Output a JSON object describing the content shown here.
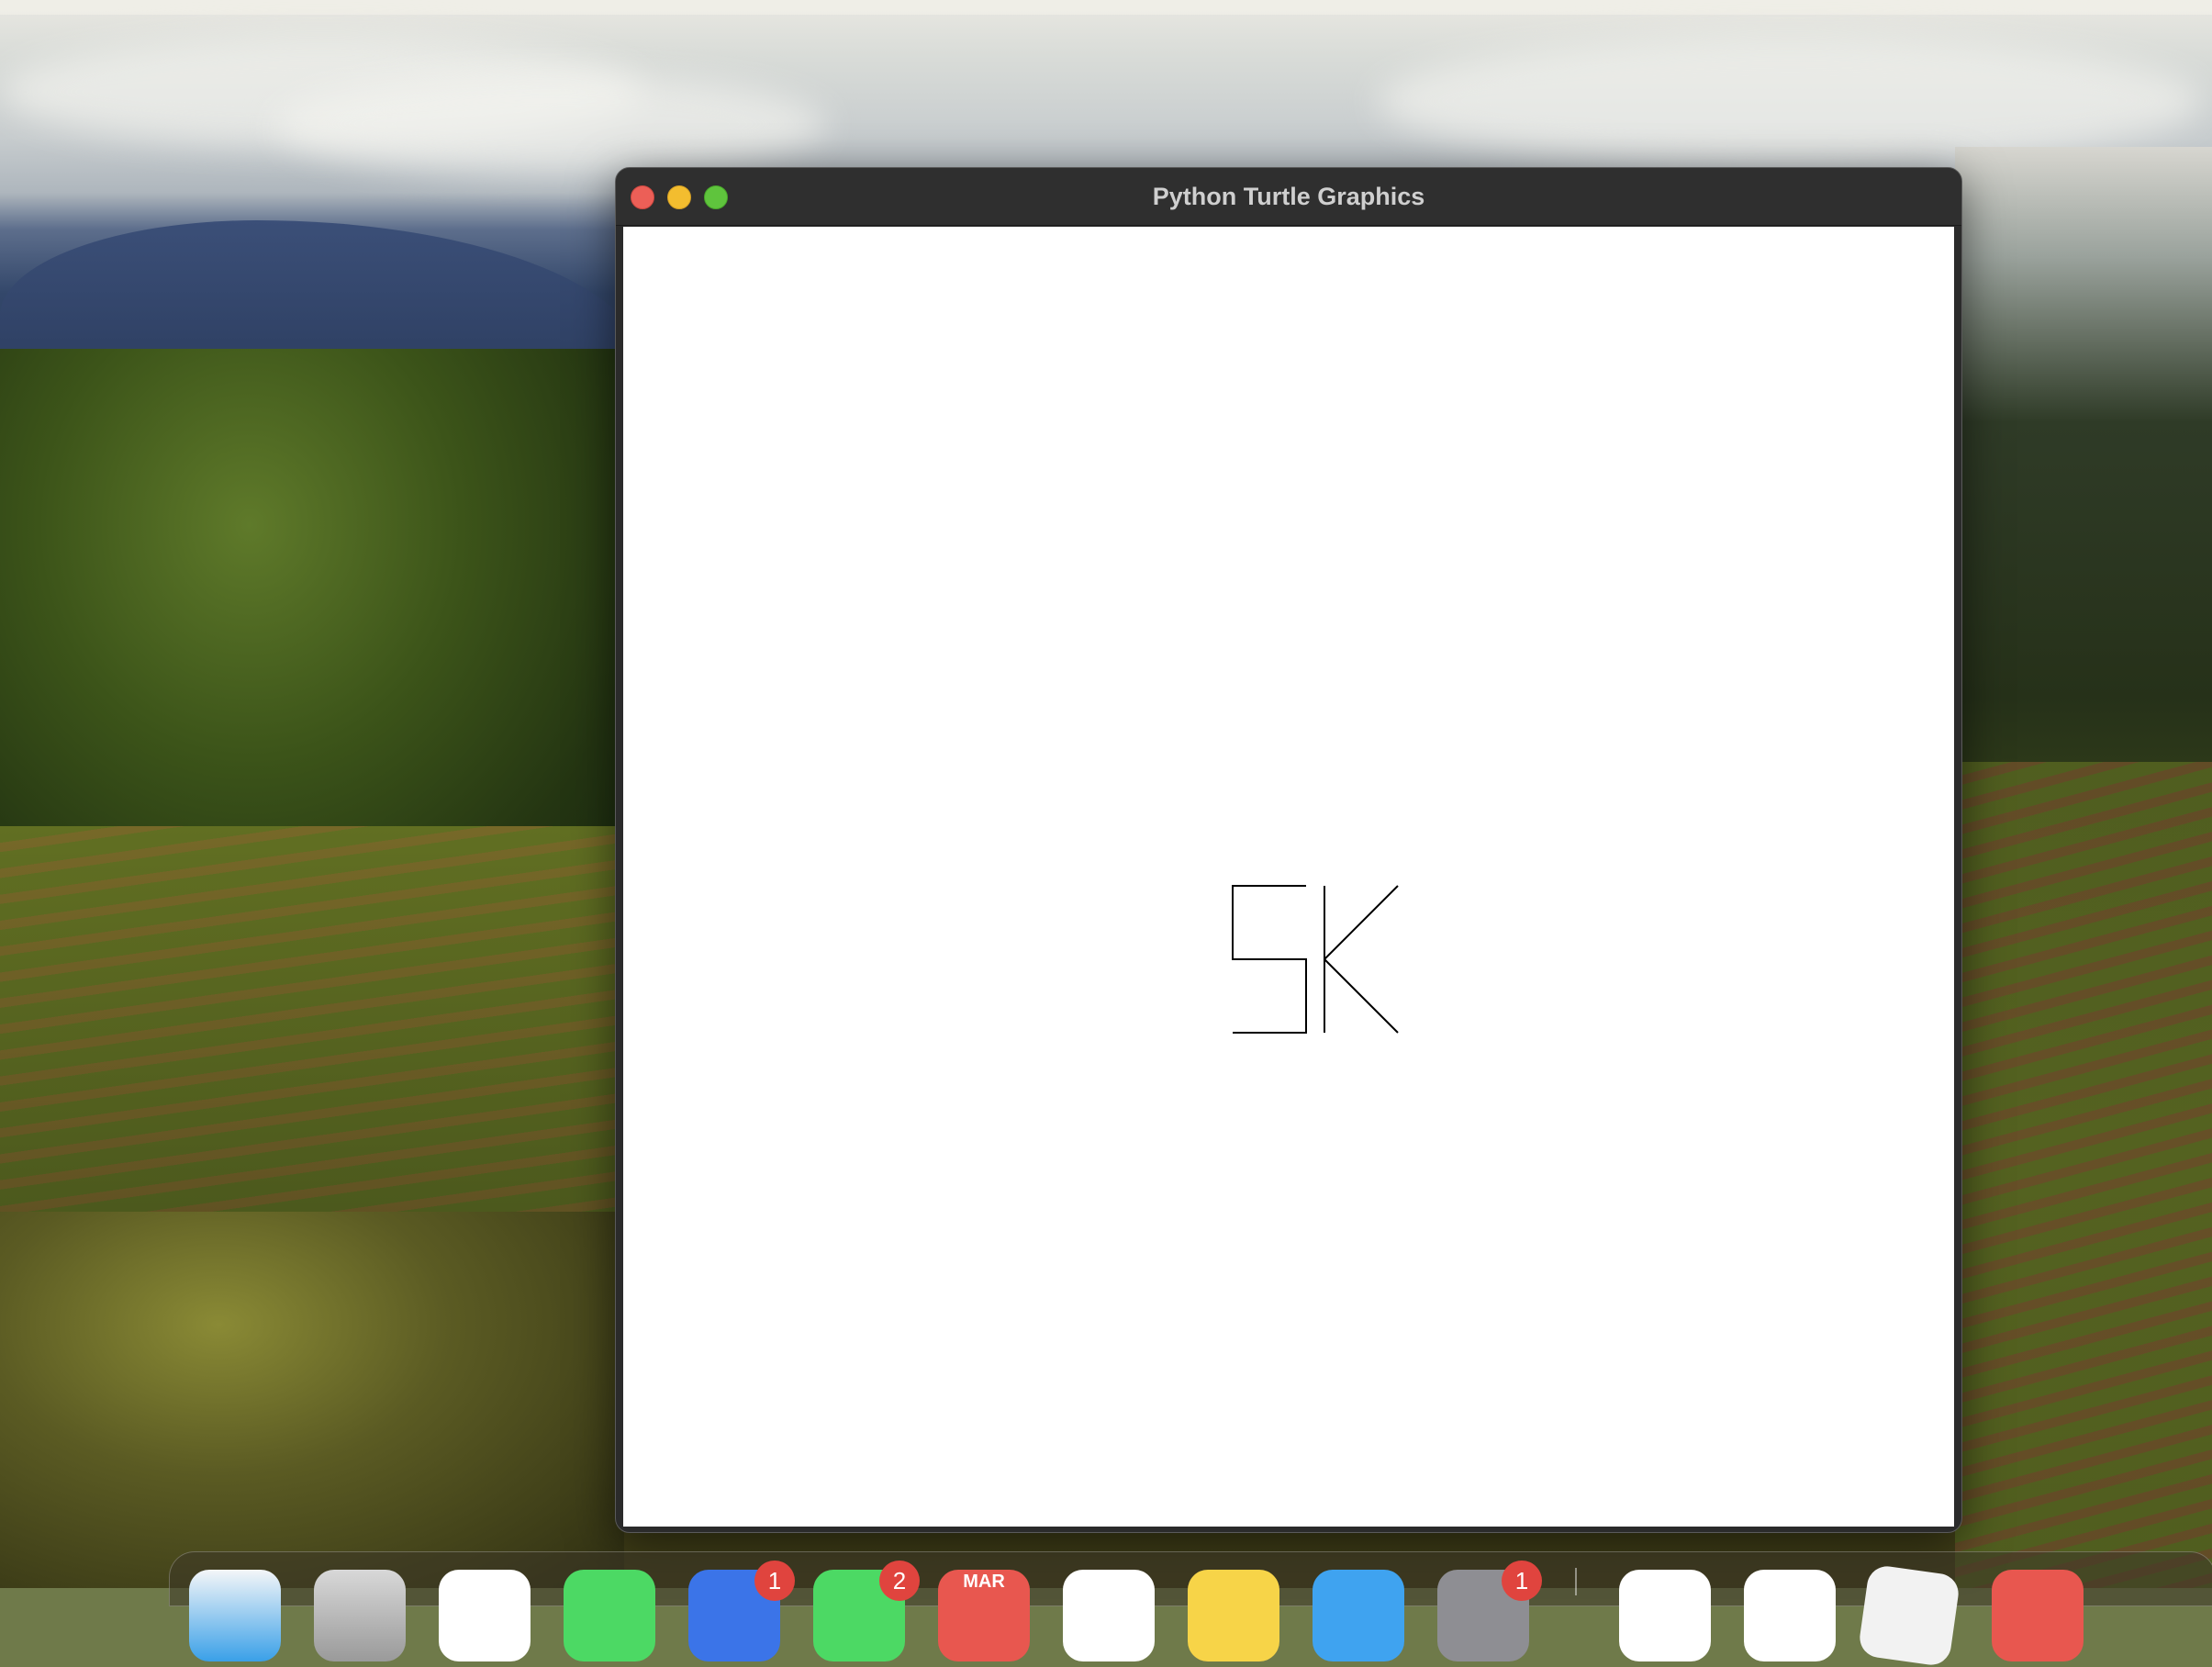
{
  "window": {
    "title": "Python Turtle Graphics"
  },
  "canvas": {
    "drawing_text": "5K",
    "stroke_color": "#000000",
    "background_color": "#ffffff"
  },
  "dock": {
    "badges": {
      "app5": "1",
      "app6": "2",
      "settings": "1"
    },
    "calendar_month": "MAR"
  }
}
